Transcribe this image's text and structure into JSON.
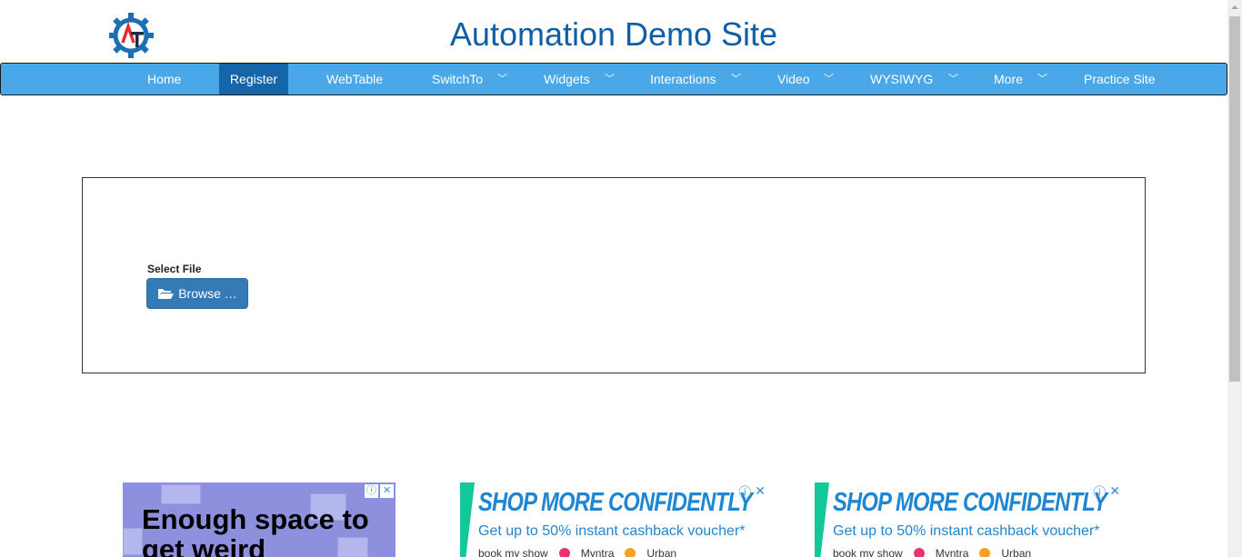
{
  "site": {
    "title": "Automation Demo Site",
    "logo_icon": "gear-logo-icon",
    "accent_color": "#0f5fa6",
    "navbar_color": "#4aa8e8",
    "active_nav_color": "#1466a8"
  },
  "nav": {
    "items": [
      {
        "label": "Home",
        "has_dropdown": false
      },
      {
        "label": "Register",
        "has_dropdown": false,
        "active": true
      },
      {
        "label": "WebTable",
        "has_dropdown": false
      },
      {
        "label": "SwitchTo",
        "has_dropdown": true
      },
      {
        "label": "Widgets",
        "has_dropdown": true
      },
      {
        "label": "Interactions",
        "has_dropdown": true
      },
      {
        "label": "Video",
        "has_dropdown": true
      },
      {
        "label": "WYSIWYG",
        "has_dropdown": true
      },
      {
        "label": "More",
        "has_dropdown": true
      },
      {
        "label": "Practice Site",
        "has_dropdown": false
      }
    ],
    "dropdown_icon": "chevron-down-icon"
  },
  "form": {
    "select_file_label": "Select File",
    "browse_button_label": "Browse …",
    "browse_icon": "folder-open-icon",
    "button_color": "#337ab7"
  },
  "ads": [
    {
      "headline": "Enough space to get weird",
      "background": "#8f90dd",
      "info_icon": "info-icon",
      "close_icon": "close-icon"
    },
    {
      "headline": "SHOP MORE CONFIDENTLY",
      "subline": "Get up to 50% instant cashback voucher*",
      "brands": [
        "book my show",
        "Myntra",
        "",
        "Urban"
      ],
      "stripe_color": "#12c79a",
      "text_color": "#1e86d2"
    },
    {
      "headline": "SHOP MORE CONFIDENTLY",
      "subline": "Get up to 50% instant cashback voucher*",
      "brands": [
        "book my show",
        "Myntra",
        "",
        "Urban"
      ],
      "stripe_color": "#12c79a",
      "text_color": "#1e86d2"
    }
  ]
}
